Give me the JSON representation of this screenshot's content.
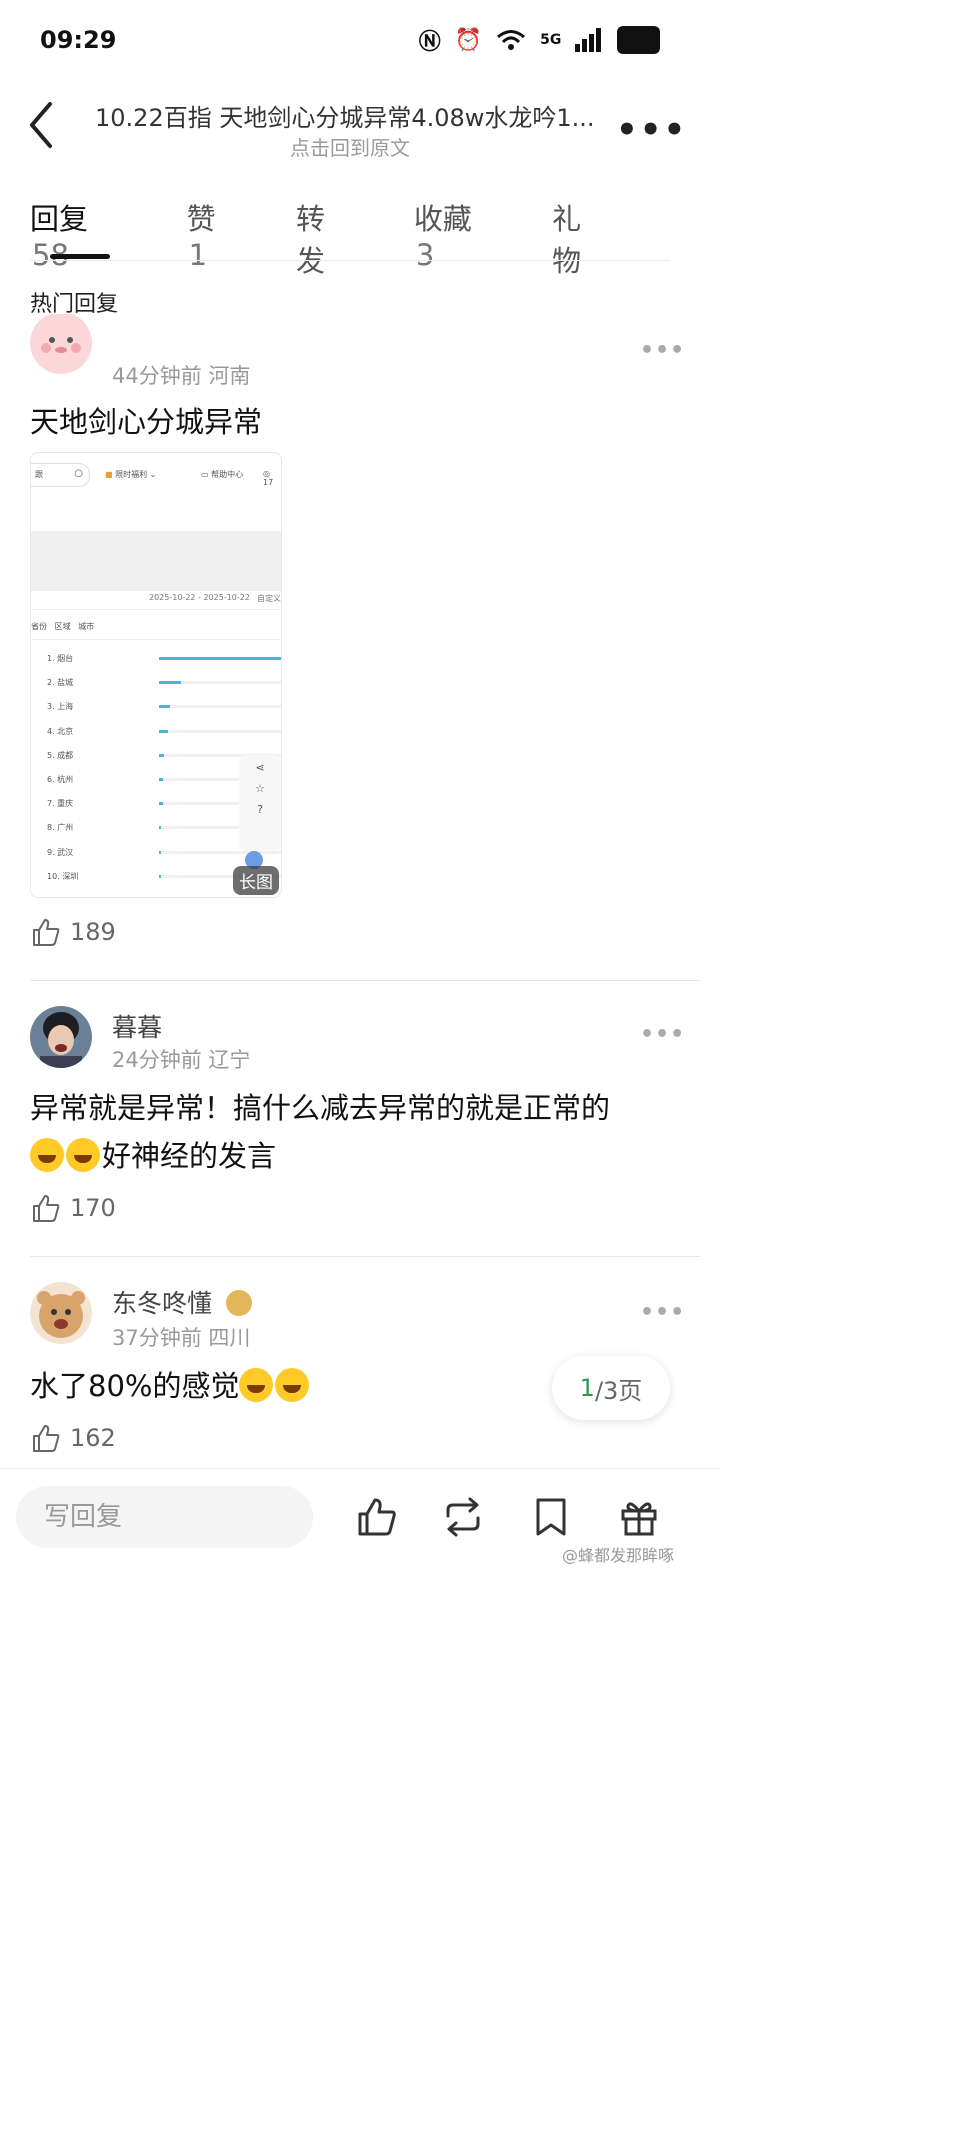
{
  "status_bar": {
    "time": "09:29",
    "network": "5G",
    "battery": "72"
  },
  "header": {
    "title": "10.22百指 天地剑心分城异常4.08w水龙吟1...",
    "subtitle": "点击回到原文"
  },
  "tabs": [
    {
      "label": "回复",
      "count": "58"
    },
    {
      "label": "赞",
      "count": "1"
    },
    {
      "label": "转发",
      "count": ""
    },
    {
      "label": "收藏",
      "count": "3"
    },
    {
      "label": "礼物",
      "count": ""
    }
  ],
  "section_title": "热门回复",
  "comments": [
    {
      "name": "",
      "time": "44分钟前",
      "location": "河南",
      "text": "天地剑心分城异常",
      "likes": "189",
      "image": {
        "search_placeholder": "跟",
        "menu_welfare": "限时福利",
        "menu_help": "帮助中心",
        "date_range": "2025-10-22 - 2025-10-22",
        "custom": "自定义",
        "filters": [
          "省份",
          "区域",
          "城市"
        ],
        "cities": [
          "烟台",
          "盐城",
          "上海",
          "北京",
          "成都",
          "杭州",
          "重庆",
          "广州",
          "武汉",
          "深圳"
        ],
        "bar_fractions": [
          1.0,
          0.18,
          0.09,
          0.07,
          0.04,
          0.03,
          0.03,
          0.02,
          0.02,
          0.02
        ],
        "long_label": "长图"
      }
    },
    {
      "name": "暮暮",
      "time": "24分钟前",
      "location": "辽宁",
      "text_line1": "异常就是异常！搞什么减去异常的就是正常的",
      "text_line2": "好神经的发言",
      "likes": "170"
    },
    {
      "name": "东冬咚懂",
      "time": "37分钟前",
      "location": "四川",
      "text": "水了80%的感觉",
      "likes": "162"
    }
  ],
  "pager": {
    "current": "1",
    "rest": "/3页"
  },
  "bottom_bar": {
    "reply_placeholder": "写回复"
  },
  "watermark": "@蜂都发那眸啄"
}
